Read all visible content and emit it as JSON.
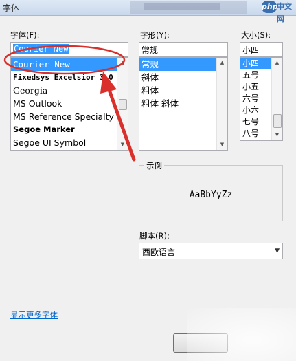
{
  "window": {
    "title": "字体"
  },
  "watermark": {
    "brand": "php",
    "site": "中文网"
  },
  "font": {
    "label": "字体(F):",
    "value": "Courier New",
    "items": [
      "Courier New",
      "Fixedsys Excelsior 3.0",
      "Georgia",
      "MS Outlook",
      "MS Reference Specialty",
      "Segoe Marker",
      "Segoe UI Symbol"
    ],
    "selected_index": 0
  },
  "style": {
    "label": "字形(Y):",
    "value": "常规",
    "items": [
      "常规",
      "斜体",
      "粗体",
      "粗体 斜体"
    ],
    "selected_index": 0
  },
  "size": {
    "label": "大小(S):",
    "value": "小四",
    "items": [
      "小四",
      "五号",
      "小五",
      "六号",
      "小六",
      "七号",
      "八号"
    ],
    "selected_index": 0
  },
  "preview": {
    "label": "示例",
    "sample": "AaBbYyZz"
  },
  "script": {
    "label": "脚本(R):",
    "value": "西欧语言"
  },
  "more_fonts_link": "显示更多字体",
  "colors": {
    "selection": "#3399ff",
    "annotation": "#d9302c",
    "link": "#0066cc"
  }
}
